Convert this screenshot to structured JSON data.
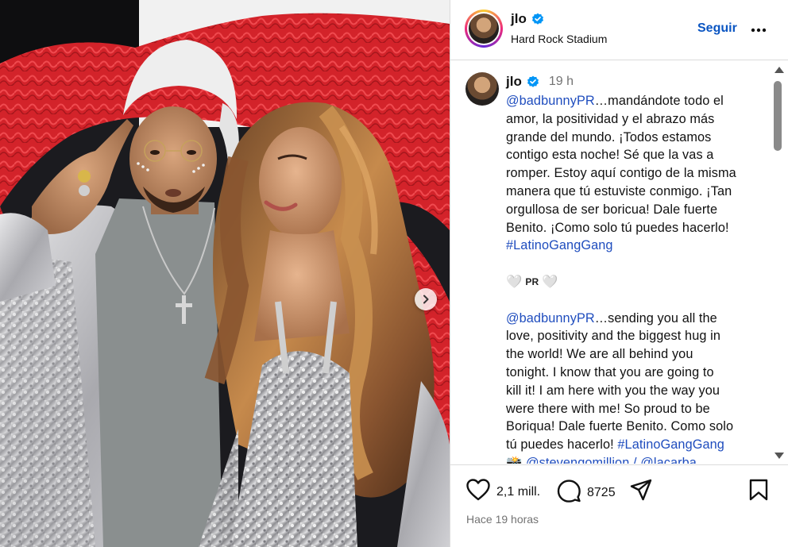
{
  "post": {
    "photo_icons": {
      "next": "chevron-right-icon"
    },
    "header": {
      "username": "jlo",
      "verified_icon": "verified-badge-icon",
      "location": "Hard Rock Stadium",
      "follow_label": "Seguir",
      "more_icon": "more-horizontal-icon"
    },
    "caption": {
      "username": "jlo",
      "time": "19 h",
      "lines": [
        {
          "mention": "@badbunnyPR",
          "text": "…mandándote todo el"
        },
        {
          "text": "amor, la positividad y el abrazo más"
        },
        {
          "text": "grande del mundo. ¡Todos estamos"
        },
        {
          "text": "contigo esta noche! Sé que la vas a"
        },
        {
          "text": "romper. Estoy aquí contigo de la misma"
        },
        {
          "text": "manera que tú estuviste conmigo. ¡Tan"
        },
        {
          "text": "orgullosa de ser boricua! Dale fuerte"
        },
        {
          "text": "Benito. ¡Como solo tú puedes hacerlo!"
        },
        {
          "hashtag": "#LatinoGangGang"
        }
      ],
      "emoji_line": {
        "left": "🤍",
        "text": "PR",
        "right": "🤍"
      },
      "lines_en": [
        {
          "mention": "@badbunnyPR",
          "text": "…sending you all the"
        },
        {
          "text": "love, positivity and the biggest hug in"
        },
        {
          "text": "the world! We are all behind you"
        },
        {
          "text": "tonight. I know that you are going to"
        },
        {
          "text": "kill it! I am here with you the way you"
        },
        {
          "text": "were there with me! So proud to be"
        },
        {
          "text": "Boriqua! Dale fuerte Benito. Como solo"
        },
        {
          "text": "tú puedes hacerlo! ",
          "hashtag": "#LatinoGangGang"
        }
      ],
      "credits": {
        "emoji": "📸",
        "mention1": "@stevengomillion",
        "separator": " / ",
        "mention2": "@lacarba"
      }
    },
    "actions": {
      "like_icon": "heart-icon",
      "likes": "2,1 mill.",
      "comment_icon": "comment-icon",
      "comments": "8725",
      "share_icon": "send-icon",
      "save_icon": "bookmark-icon",
      "time_ago": "Hace 19 horas"
    },
    "colors": {
      "link": "#1f4dbe",
      "follow": "#0a55c2",
      "muted": "#737373",
      "verified": "#0095f6",
      "feathers": "#d3232a"
    }
  }
}
